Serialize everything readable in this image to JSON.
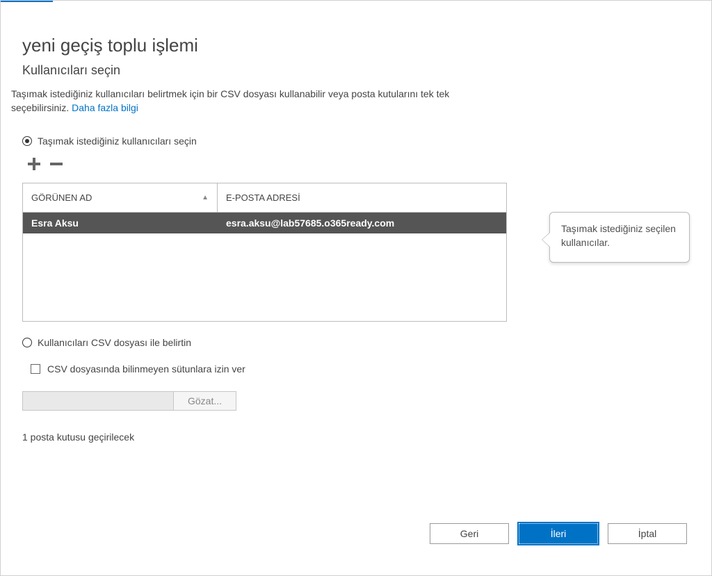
{
  "header": {
    "title": "yeni geçiş toplu işlemi",
    "subtitle": "Kullanıcıları seçin"
  },
  "description": {
    "text_before": "Taşımak istediğiniz kullanıcıları belirtmek için bir CSV dosyası kullanabilir veya posta kutularını tek tek seçebilirsiniz. ",
    "link_text": "Daha fazla bilgi"
  },
  "options": {
    "select_users_label": "Taşımak istediğiniz kullanıcıları seçin",
    "csv_label": "Kullanıcıları CSV dosyası ile belirtin",
    "csv_allow_unknown": "CSV dosyasında bilinmeyen sütunlara izin ver",
    "browse_button": "Gözat..."
  },
  "table": {
    "columns": {
      "display_name": "GÖRÜNEN AD",
      "email": "E-POSTA ADRESİ"
    },
    "rows": [
      {
        "name": "Esra Aksu",
        "email": "esra.aksu@lab57685.o365ready.com"
      }
    ]
  },
  "icons": {
    "plus": "plus-icon",
    "minus": "minus-icon",
    "sort": "sort-asc-icon"
  },
  "status": "1 posta kutusu geçirilecek",
  "callout": "Taşımak istediğiniz seçilen kullanıcılar.",
  "buttons": {
    "back": "Geri",
    "next": "İleri",
    "cancel": "İptal"
  },
  "colors": {
    "accent": "#0072c6",
    "selected_row": "#555555"
  }
}
